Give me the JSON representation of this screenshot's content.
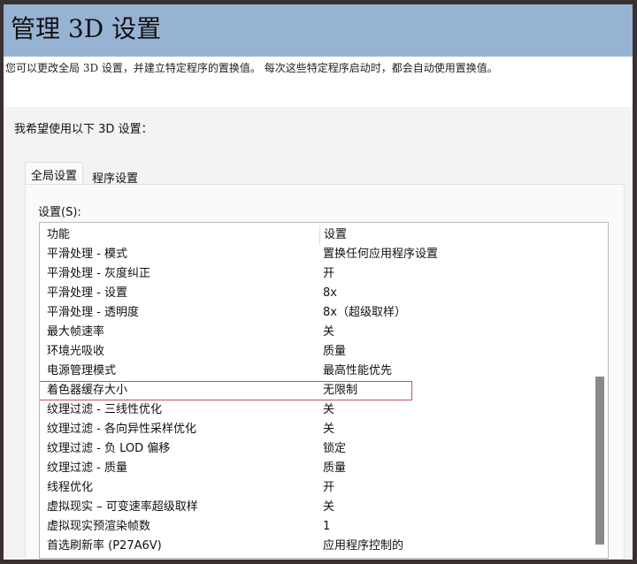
{
  "title": "管理 3D 设置",
  "description": "您可以更改全局 3D 设置，并建立特定程序的置换值。 每次这些特定程序启动时，都会自动使用置换值。",
  "prompt": "我希望使用以下 3D 设置：",
  "tabs": [
    "全局设置",
    "程序设置"
  ],
  "settings_label": "设置(S):",
  "columns": [
    "功能",
    "设置"
  ],
  "rows": [
    {
      "feature": "平滑处理 - 模式",
      "value": "置换任何应用程序设置"
    },
    {
      "feature": "平滑处理 - 灰度纠正",
      "value": "开"
    },
    {
      "feature": "平滑处理 - 设置",
      "value": "8x"
    },
    {
      "feature": "平滑处理 - 透明度",
      "value": "8x（超级取样）"
    },
    {
      "feature": "最大帧速率",
      "value": "关"
    },
    {
      "feature": "环境光吸收",
      "value": "质量"
    },
    {
      "feature": "电源管理模式",
      "value": "最高性能优先"
    },
    {
      "feature": "着色器缓存大小",
      "value": "无限制"
    },
    {
      "feature": "纹理过滤 - 三线性优化",
      "value": "关"
    },
    {
      "feature": "纹理过滤 - 各向异性采样优化",
      "value": "关"
    },
    {
      "feature": "纹理过滤 - 负 LOD 偏移",
      "value": "锁定"
    },
    {
      "feature": "纹理过滤 - 质量",
      "value": "质量"
    },
    {
      "feature": "线程优化",
      "value": "开"
    },
    {
      "feature": "虚拟现实 – 可变速率超级取样",
      "value": "关"
    },
    {
      "feature": "虚拟现实预渲染帧数",
      "value": "1"
    },
    {
      "feature": "首选刷新率 (P27A6V)",
      "value": "应用程序控制的"
    }
  ],
  "highlighted_row": 7,
  "colors": {
    "header": "#97b3d4",
    "highlight": "#c0505a"
  }
}
